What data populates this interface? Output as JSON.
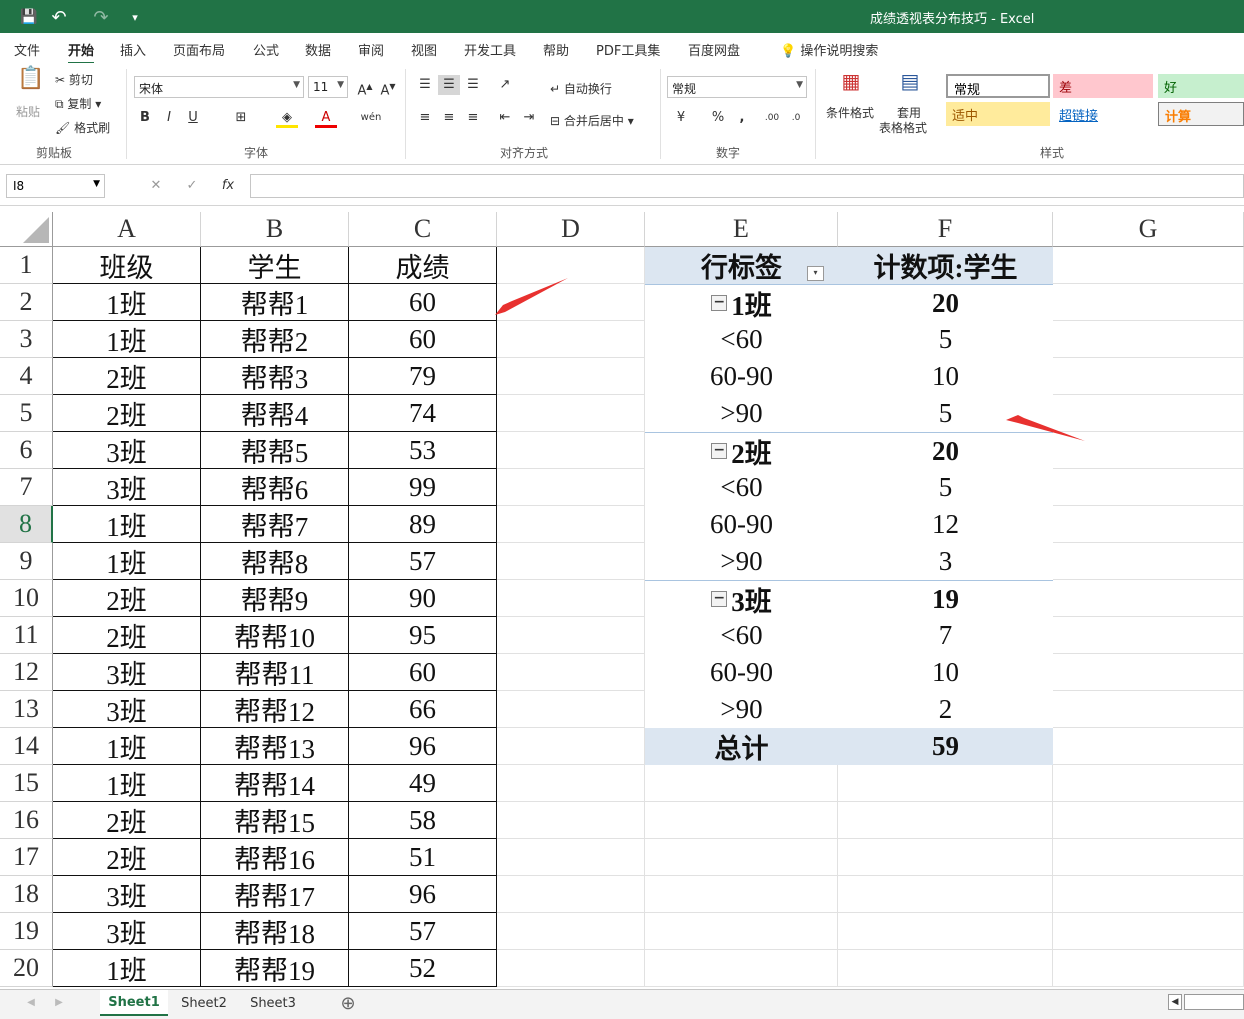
{
  "window": {
    "title": "成绩透视表分布技巧 - Excel"
  },
  "qat": {
    "save": "💾",
    "undo": "↶",
    "redo": "↷",
    "more": "▾"
  },
  "menu": [
    "文件",
    "开始",
    "插入",
    "页面布局",
    "公式",
    "数据",
    "审阅",
    "视图",
    "开发工具",
    "帮助",
    "PDF工具集",
    "百度网盘",
    "操作说明搜索"
  ],
  "ribbon": {
    "clipboard": {
      "paste": "粘贴",
      "cut": "剪切",
      "copy": "复制",
      "format_painter": "格式刷",
      "label": "剪贴板"
    },
    "font": {
      "name": "宋体",
      "size": "11",
      "label": "字体",
      "bold": "B",
      "italic": "I",
      "underline": "U"
    },
    "align": {
      "wrap": "自动换行",
      "merge": "合并后居中",
      "label": "对齐方式"
    },
    "number": {
      "format": "常规",
      "label": "数字",
      "percent": "%",
      "comma": ","
    },
    "styles": {
      "cond": "条件格式",
      "table_line1": "套用",
      "table_line2": "表格格式",
      "label": "样式",
      "normal": "常规",
      "bad": "差",
      "good": "好",
      "neutral": "适中",
      "hyperlink": "超链接",
      "calc": "计算"
    }
  },
  "formula_bar": {
    "namebox": "I8",
    "formula": ""
  },
  "columns": [
    "A",
    "B",
    "C",
    "D",
    "E",
    "F",
    "G"
  ],
  "rows": [
    "1",
    "2",
    "3",
    "4",
    "5",
    "6",
    "7",
    "8",
    "9",
    "10",
    "11",
    "12",
    "13",
    "14",
    "15",
    "16",
    "17",
    "18",
    "19",
    "20"
  ],
  "table": {
    "headers": [
      "班级",
      "学生",
      "成绩"
    ],
    "rows": [
      [
        "1班",
        "帮帮1",
        "60"
      ],
      [
        "1班",
        "帮帮2",
        "60"
      ],
      [
        "2班",
        "帮帮3",
        "79"
      ],
      [
        "2班",
        "帮帮4",
        "74"
      ],
      [
        "3班",
        "帮帮5",
        "53"
      ],
      [
        "3班",
        "帮帮6",
        "99"
      ],
      [
        "1班",
        "帮帮7",
        "89"
      ],
      [
        "1班",
        "帮帮8",
        "57"
      ],
      [
        "2班",
        "帮帮9",
        "90"
      ],
      [
        "2班",
        "帮帮10",
        "95"
      ],
      [
        "3班",
        "帮帮11",
        "60"
      ],
      [
        "3班",
        "帮帮12",
        "66"
      ],
      [
        "1班",
        "帮帮13",
        "96"
      ],
      [
        "1班",
        "帮帮14",
        "49"
      ],
      [
        "2班",
        "帮帮15",
        "58"
      ],
      [
        "2班",
        "帮帮16",
        "51"
      ],
      [
        "3班",
        "帮帮17",
        "96"
      ],
      [
        "3班",
        "帮帮18",
        "57"
      ],
      [
        "1班",
        "帮帮19",
        "52"
      ]
    ]
  },
  "pivot": {
    "header_row": "行标签",
    "header_value": "计数项:学生",
    "collapse_glyph": "−",
    "filter_glyph": "▾",
    "rows": [
      {
        "label": "1班",
        "value": "20",
        "group": true
      },
      {
        "label": "<60",
        "value": "5",
        "group": false
      },
      {
        "label": "60-90",
        "value": "10",
        "group": false
      },
      {
        "label": ">90",
        "value": "5",
        "group": false
      },
      {
        "label": "2班",
        "value": "20",
        "group": true
      },
      {
        "label": "<60",
        "value": "5",
        "group": false
      },
      {
        "label": "60-90",
        "value": "12",
        "group": false
      },
      {
        "label": ">90",
        "value": "3",
        "group": false
      },
      {
        "label": "3班",
        "value": "19",
        "group": true
      },
      {
        "label": "<60",
        "value": "7",
        "group": false
      },
      {
        "label": "60-90",
        "value": "10",
        "group": false
      },
      {
        "label": ">90",
        "value": "2",
        "group": false
      }
    ],
    "total_label": "总计",
    "total_value": "59"
  },
  "sheets": [
    "Sheet1",
    "Sheet2",
    "Sheet3"
  ],
  "add_sheet": "⊕",
  "colors": {
    "accent": "#217346",
    "arrow": "#e8312f",
    "pivot_header": "#dce6f1"
  }
}
